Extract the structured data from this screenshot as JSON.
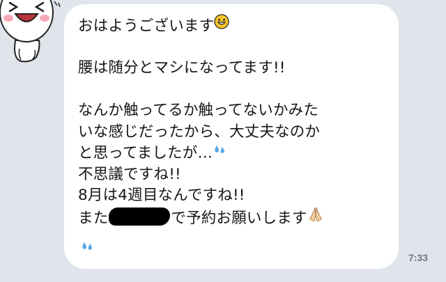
{
  "colors": {
    "background": "#dfe5ea",
    "bubble": "#ffffff",
    "text": "#161616",
    "time": "#6f7780",
    "redaction": "#000000"
  },
  "sticker": {
    "icon": "laughing-character-sticker"
  },
  "message": {
    "lines": [
      "おはようございます",
      "",
      "腰は随分とマシになってます!!",
      "",
      "なんか触ってるか触ってないかみた",
      "いな感じだったから、大丈夫なのか",
      "と思ってましたが…",
      "不思議ですね!!",
      "8月は4週目なんですね!!",
      "また",
      "で予約お願いします"
    ],
    "icons": {
      "smile": "smiling-face-emoji",
      "sweat": "sweat-droplets-emoji",
      "pray": "folded-hands-emoji",
      "redacted": "redacted-text-block"
    }
  },
  "timestamp": "7:33"
}
